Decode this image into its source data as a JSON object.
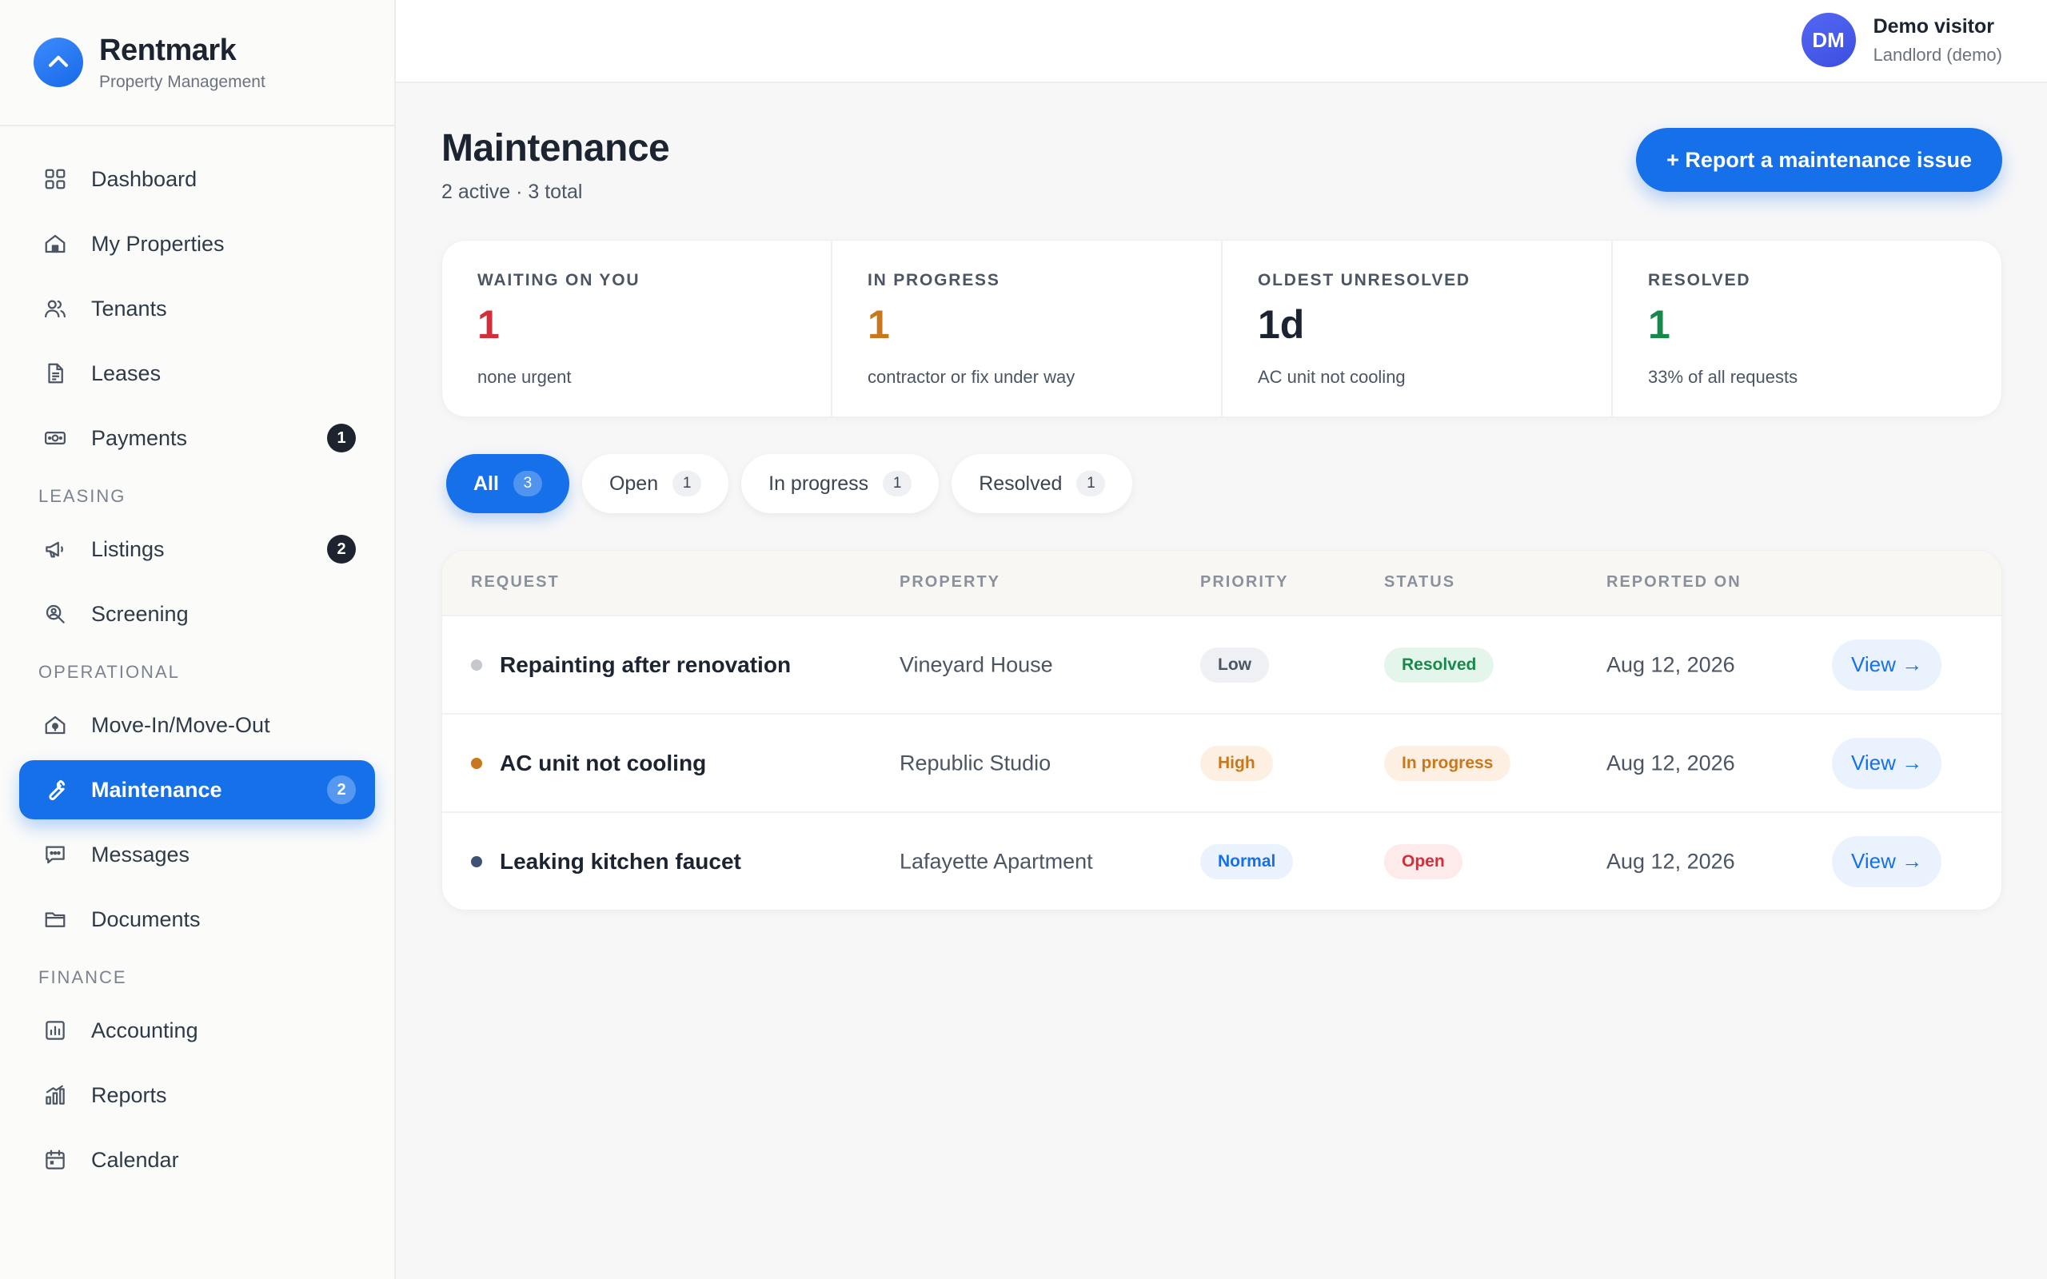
{
  "brand": {
    "name": "Rentmark",
    "subtitle": "Property Management"
  },
  "user": {
    "initials": "DM",
    "name": "Demo visitor",
    "role": "Landlord (demo)"
  },
  "nav": {
    "main": [
      {
        "label": "Dashboard",
        "icon": "dashboard-icon"
      },
      {
        "label": "My Properties",
        "icon": "home-icon"
      },
      {
        "label": "Tenants",
        "icon": "users-icon"
      },
      {
        "label": "Leases",
        "icon": "document-icon"
      },
      {
        "label": "Payments",
        "icon": "money-icon",
        "badge": "1"
      }
    ],
    "leasing_title": "LEASING",
    "leasing": [
      {
        "label": "Listings",
        "icon": "megaphone-icon",
        "badge": "2"
      },
      {
        "label": "Screening",
        "icon": "search-person-icon"
      }
    ],
    "operational_title": "OPERATIONAL",
    "operational": [
      {
        "label": "Move-In/Move-Out",
        "icon": "house-key-icon"
      },
      {
        "label": "Maintenance",
        "icon": "wrench-icon",
        "badge": "2"
      },
      {
        "label": "Messages",
        "icon": "message-icon"
      },
      {
        "label": "Documents",
        "icon": "folder-icon"
      }
    ],
    "finance_title": "FINANCE",
    "finance": [
      {
        "label": "Accounting",
        "icon": "ledger-icon"
      },
      {
        "label": "Reports",
        "icon": "bar-chart-icon"
      },
      {
        "label": "Calendar",
        "icon": "calendar-icon"
      }
    ]
  },
  "page": {
    "title": "Maintenance",
    "subtitle": "2 active · 3 total",
    "report_button": "+ Report a maintenance issue"
  },
  "stats": [
    {
      "label": "WAITING ON YOU",
      "value": "1",
      "note": "none urgent",
      "color": "#d32f3b"
    },
    {
      "label": "IN PROGRESS",
      "value": "1",
      "note": "contractor or fix under way",
      "color": "#c9771d"
    },
    {
      "label": "OLDEST UNRESOLVED",
      "value": "1d",
      "note": "AC unit not cooling",
      "color": "#1b2430"
    },
    {
      "label": "RESOLVED",
      "value": "1",
      "note": "33% of all requests",
      "color": "#178a4b"
    }
  ],
  "tabs": [
    {
      "label": "All",
      "count": "3"
    },
    {
      "label": "Open",
      "count": "1"
    },
    {
      "label": "In progress",
      "count": "1"
    },
    {
      "label": "Resolved",
      "count": "1"
    }
  ],
  "table": {
    "headers": {
      "request": "REQUEST",
      "property": "PROPERTY",
      "priority": "PRIORITY",
      "status": "STATUS",
      "reported": "REPORTED ON"
    },
    "rows": [
      {
        "request": "Repainting after renovation",
        "property": "Vineyard House",
        "priority": "Low",
        "status": "Resolved",
        "reported": "Aug 12, 2026",
        "action": "View →",
        "dot_color": "#c4c7cc"
      },
      {
        "request": "AC unit not cooling",
        "property": "Republic Studio",
        "priority": "High",
        "status": "In progress",
        "reported": "Aug 12, 2026",
        "action": "View →",
        "dot_color": "#c9771d"
      },
      {
        "request": "Leaking kitchen faucet",
        "property": "Lafayette Apartment",
        "priority": "Normal",
        "status": "Open",
        "reported": "Aug 12, 2026",
        "action": "View →",
        "dot_color": "#3d5275"
      }
    ]
  },
  "colors": {
    "accent": "#1670ea",
    "priority": {
      "Low": [
        "#eef0f3",
        "#4b5563"
      ],
      "High": [
        "#fdf0e2",
        "#c9771d"
      ],
      "Normal": [
        "#eaf2fe",
        "#1670ea"
      ]
    },
    "status": {
      "Resolved": [
        "#e4f6ec",
        "#178a4b"
      ],
      "In progress": [
        "#fdf0e2",
        "#c9771d"
      ],
      "Open": [
        "#fdeaea",
        "#d32f3b"
      ]
    }
  }
}
